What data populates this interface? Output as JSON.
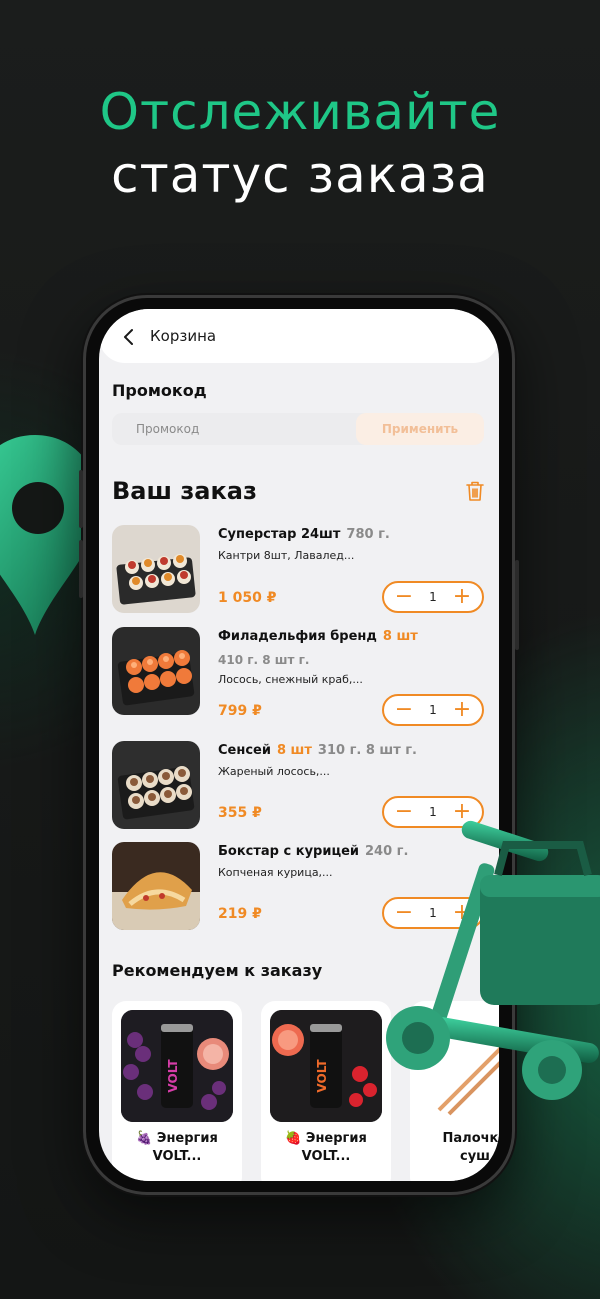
{
  "headline": {
    "line1": "Отслеживайте",
    "line2": "статус заказа"
  },
  "colors": {
    "accent_green": "#1fc787",
    "accent_orange": "#f08a24",
    "screen_bg": "#f1f1f3"
  },
  "app": {
    "topbar": {
      "title": "Корзина",
      "back_icon": "chevron-left-icon"
    },
    "promo": {
      "label": "Промокод",
      "placeholder": "Промокод",
      "apply_label": "Применить"
    },
    "order": {
      "title": "Ваш заказ",
      "trash_icon": "trash-icon",
      "items": [
        {
          "name": "Суперстар 24шт",
          "weight": "780 г.",
          "desc": "Кантри 8шт, Лавалед...",
          "price": "1 050 ₽",
          "qty": "1"
        },
        {
          "name": "Филадельфия бренд",
          "pcs": "8 шт",
          "subline": "410 г.  8 шт г.",
          "desc": "Лосось, снежный краб,...",
          "price": "799 ₽",
          "qty": "1"
        },
        {
          "name": "Сенсей",
          "pcs": "8 шт",
          "weight": "310 г.  8 шт г.",
          "desc": "Жареный лосось,...",
          "price": "355 ₽",
          "qty": "1"
        },
        {
          "name": "Бокстар с курицей",
          "weight": "240 г.",
          "desc": "Копченая курица,...",
          "price": "219 ₽",
          "qty": "1"
        }
      ],
      "minus": "−",
      "plus": "+"
    },
    "recommend": {
      "title": "Рекомендуем к заказу",
      "items": [
        {
          "icon": "🍇",
          "line1": "Энергия",
          "line2": "VOLT..."
        },
        {
          "icon": "🍓",
          "line1": "Энергия",
          "line2": "VOLT..."
        },
        {
          "icon": "",
          "line1": "Палочки",
          "line2": "суш"
        }
      ]
    }
  }
}
